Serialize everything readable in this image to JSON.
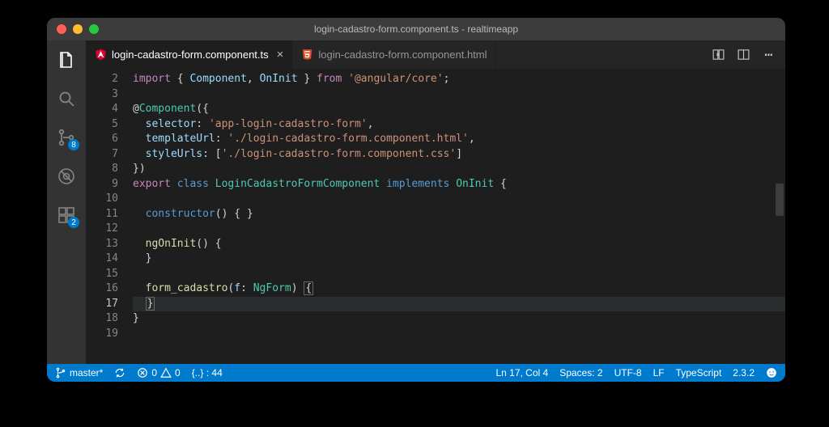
{
  "window_title": "login-cadastro-form.component.ts - realtimeapp",
  "tabs": [
    {
      "label": "login-cadastro-form.component.ts",
      "icon": "angular",
      "active": true
    },
    {
      "label": "login-cadastro-form.component.html",
      "icon": "html5",
      "active": false
    }
  ],
  "activity_badges": {
    "scm": "8",
    "extensions": "2"
  },
  "editor": {
    "first_line_number": 2,
    "lines": [
      [
        [
          "k-purple",
          "import"
        ],
        [
          "k-white",
          " { "
        ],
        [
          "k-lblue",
          "Component"
        ],
        [
          "k-white",
          ", "
        ],
        [
          "k-lblue",
          "OnInit"
        ],
        [
          "k-white",
          " } "
        ],
        [
          "k-purple",
          "from"
        ],
        [
          "k-white",
          " "
        ],
        [
          "k-string",
          "'@angular/core'"
        ],
        [
          "k-white",
          ";"
        ]
      ],
      [],
      [
        [
          "k-white",
          "@"
        ],
        [
          "k-teal",
          "Component"
        ],
        [
          "k-white",
          "({"
        ]
      ],
      [
        [
          "k-white",
          "  "
        ],
        [
          "k-lblue",
          "selector"
        ],
        [
          "k-white",
          ": "
        ],
        [
          "k-string",
          "'app-login-cadastro-form'"
        ],
        [
          "k-white",
          ","
        ]
      ],
      [
        [
          "k-white",
          "  "
        ],
        [
          "k-lblue",
          "templateUrl"
        ],
        [
          "k-white",
          ": "
        ],
        [
          "k-string",
          "'./login-cadastro-form.component.html'"
        ],
        [
          "k-white",
          ","
        ]
      ],
      [
        [
          "k-white",
          "  "
        ],
        [
          "k-lblue",
          "styleUrls"
        ],
        [
          "k-white",
          ": ["
        ],
        [
          "k-string",
          "'./login-cadastro-form.component.css'"
        ],
        [
          "k-white",
          "]"
        ]
      ],
      [
        [
          "k-white",
          "})"
        ]
      ],
      [
        [
          "k-purple",
          "export"
        ],
        [
          "k-white",
          " "
        ],
        [
          "k-blue",
          "class"
        ],
        [
          "k-white",
          " "
        ],
        [
          "k-teal",
          "LoginCadastroFormComponent"
        ],
        [
          "k-white",
          " "
        ],
        [
          "k-blue",
          "implements"
        ],
        [
          "k-white",
          " "
        ],
        [
          "k-teal",
          "OnInit"
        ],
        [
          "k-white",
          " {"
        ]
      ],
      [],
      [
        [
          "k-white",
          "  "
        ],
        [
          "k-blue",
          "constructor"
        ],
        [
          "k-white",
          "() { }"
        ]
      ],
      [],
      [
        [
          "k-white",
          "  "
        ],
        [
          "k-yellow",
          "ngOnInit"
        ],
        [
          "k-white",
          "() {"
        ]
      ],
      [
        [
          "k-white",
          "  }"
        ]
      ],
      [],
      [
        [
          "k-white",
          "  "
        ],
        [
          "k-yellow",
          "form_cadastro"
        ],
        [
          "k-white",
          "("
        ],
        [
          "k-lblue",
          "f"
        ],
        [
          "k-white",
          ": "
        ],
        [
          "k-teal",
          "NgForm"
        ],
        [
          "k-white",
          ") "
        ],
        [
          "bracket",
          "{"
        ]
      ],
      [
        [
          "k-white",
          "  "
        ],
        [
          "bracket",
          "}"
        ]
      ],
      [
        [
          "k-white",
          "}"
        ]
      ],
      []
    ],
    "current_line_index": 15
  },
  "status": {
    "branch": "master*",
    "errors": "0",
    "warnings": "0",
    "symbols": "{..} : 44",
    "cursor": "Ln 17, Col 4",
    "spaces": "Spaces: 2",
    "encoding": "UTF-8",
    "eol": "LF",
    "language": "TypeScript",
    "version": "2.3.2"
  }
}
